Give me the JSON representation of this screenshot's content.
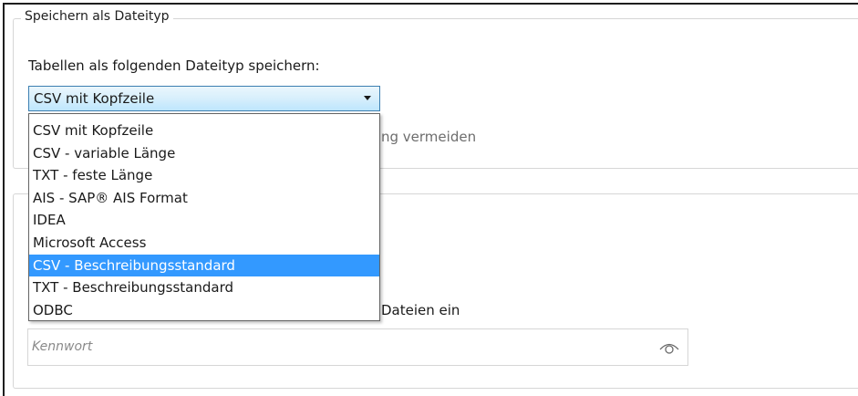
{
  "group_filetype": {
    "legend": "Speichern als Dateityp",
    "label": "Tabellen als folgenden Dateityp speichern:",
    "combo_value": "CSV mit Kopfzeile",
    "options": [
      "CSV mit Kopfzeile",
      "CSV - variable Länge",
      "TXT - feste Länge",
      "AIS - SAP® AIS Format",
      "IDEA",
      "Microsoft Access",
      "CSV - Beschreibungsstandard",
      "TXT - Beschreibungsstandard",
      "ODBC"
    ],
    "highlighted_option": "CSV - Beschreibungsstandard",
    "partial_checkbox_text": "ng vermeiden"
  },
  "group_password": {
    "partial_label": "Dateien ein",
    "password_placeholder": "Kennwort",
    "reveal_icon": "eye-icon"
  },
  "colors": {
    "selection": "#3399ff",
    "combo_border": "#3c7fb1",
    "group_border": "#d6d6d6"
  }
}
